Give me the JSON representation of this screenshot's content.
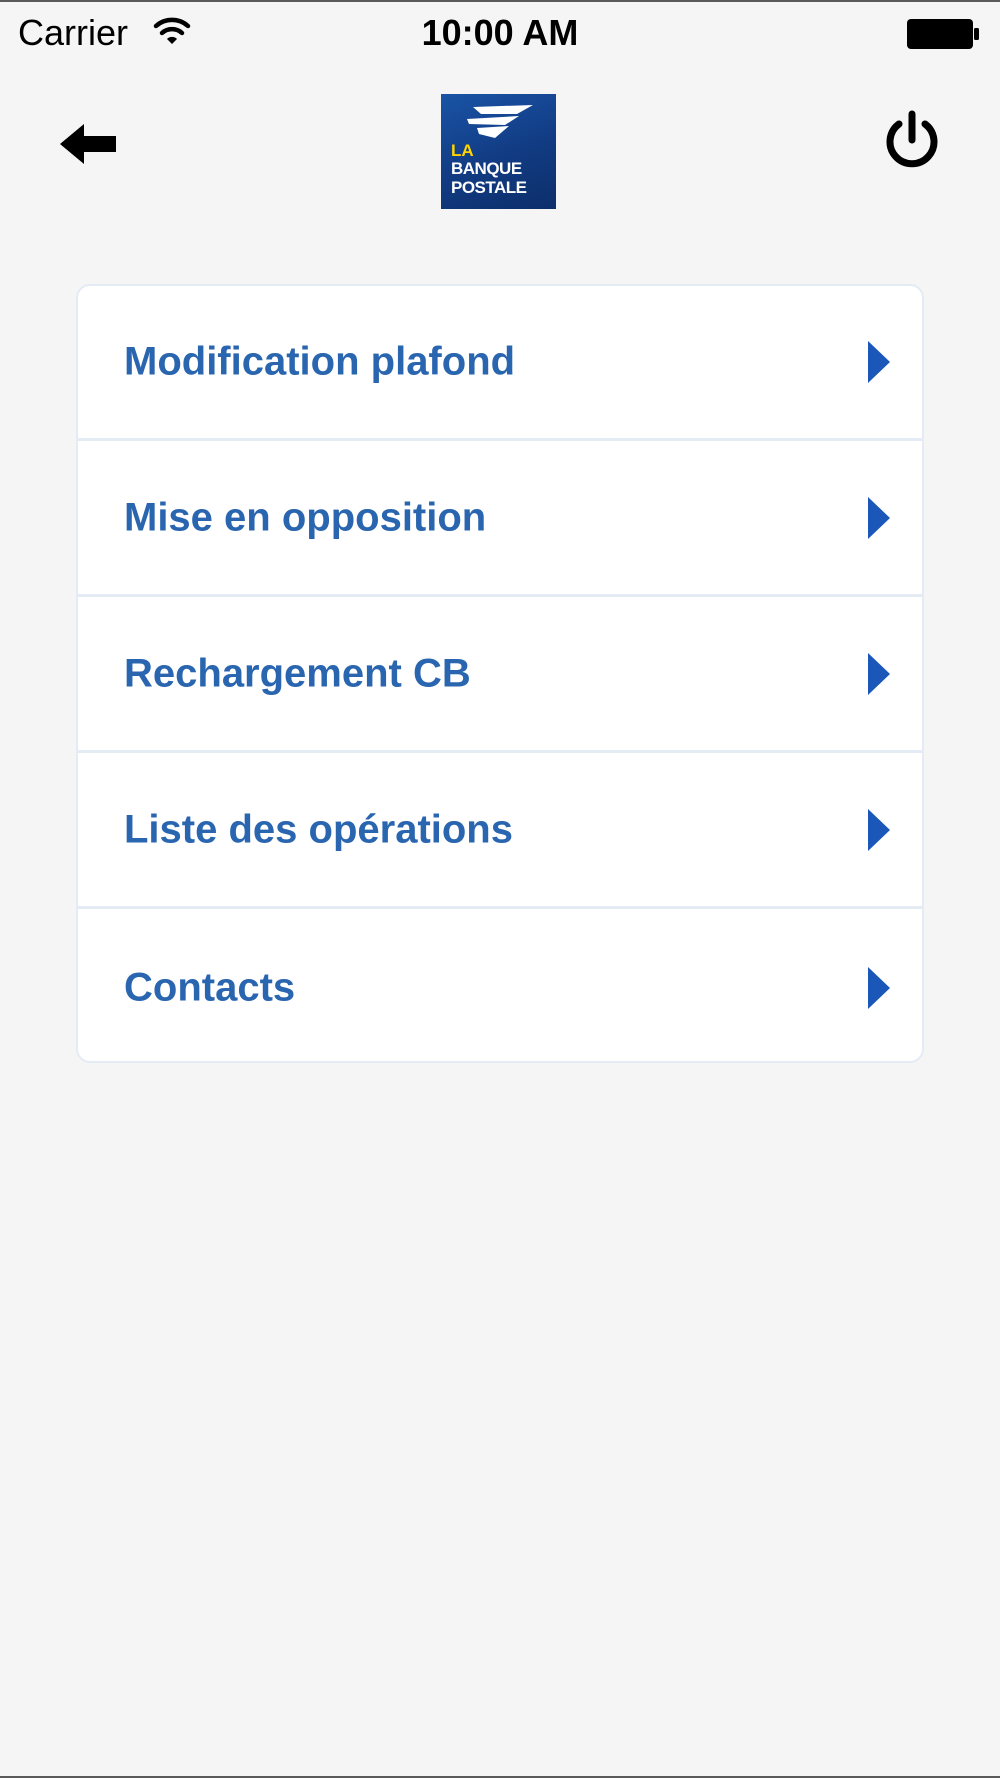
{
  "status_bar": {
    "carrier": "Carrier",
    "time": "10:00 AM"
  },
  "nav": {
    "back_icon": "back-arrow-icon",
    "power_icon": "power-icon"
  },
  "logo": {
    "line1": "LA",
    "line2": "BANQUE",
    "line3": "POSTALE"
  },
  "menu": {
    "items": [
      {
        "label": "Modification plafond"
      },
      {
        "label": "Mise en opposition"
      },
      {
        "label": "Rechargement CB"
      },
      {
        "label": "Liste des opérations"
      },
      {
        "label": "Contacts"
      }
    ]
  },
  "colors": {
    "background": "#f5f5f5",
    "item_text": "#2a66b0",
    "chevron": "#1a57b8",
    "logo_blue": "#113b82",
    "logo_yellow": "#ffd400"
  }
}
